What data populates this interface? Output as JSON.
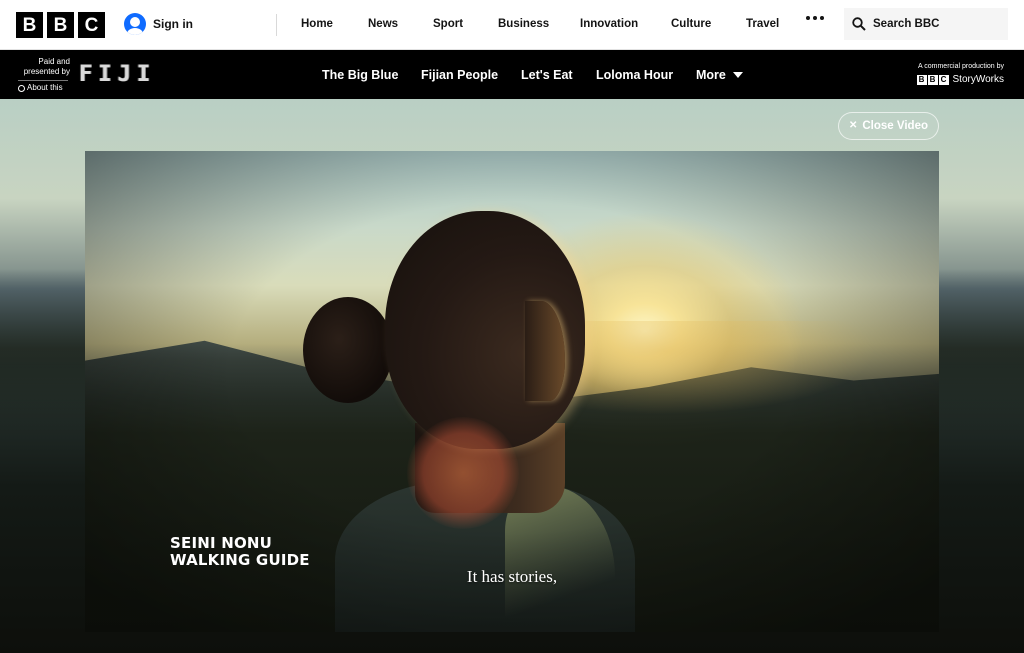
{
  "header": {
    "logo_letters": [
      "B",
      "B",
      "C"
    ],
    "signin_label": "Sign in",
    "nav": [
      "Home",
      "News",
      "Sport",
      "Business",
      "Innovation",
      "Culture",
      "Travel"
    ],
    "more_icon": "ellipsis-icon",
    "search_label": "Search BBC",
    "search_icon": "search-icon"
  },
  "sponsor_bar": {
    "paid_line_1": "Paid and",
    "paid_line_2": "presented by",
    "about_label": "About this",
    "sponsor_logo": "FIJI",
    "story_nav": [
      "The Big Blue",
      "Fijian People",
      "Let's Eat",
      "Loloma Hour",
      "More"
    ],
    "commercial_label": "A commercial production by",
    "storyworks_letters": [
      "B",
      "B",
      "C"
    ],
    "storyworks_label": "StoryWorks"
  },
  "video": {
    "close_label": "Close Video",
    "name_line_1": "SEINI NONU",
    "name_line_2": "WALKING GUIDE",
    "subtitle": "It has stories,"
  },
  "colors": {
    "brand_black": "#000000",
    "signin_blue": "#0f6bff",
    "header_text": "#141414",
    "search_bg": "#f5f5f5"
  }
}
